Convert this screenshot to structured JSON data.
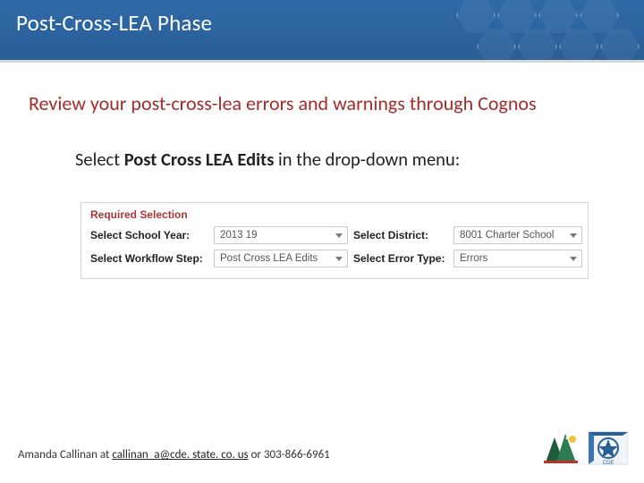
{
  "header": {
    "title": "Post-Cross-LEA Phase"
  },
  "subtitle": "Review your post-cross-lea errors and warnings through Cognos",
  "instruction": {
    "prefix": "Select ",
    "bold": "Post Cross LEA Edits",
    "suffix": " in the drop-down menu:"
  },
  "panel": {
    "legend": "Required Selection",
    "rows": [
      {
        "label1": "Select School Year:",
        "value1": "2013 19",
        "label2": "Select District:",
        "value2": "8001   Charter School"
      },
      {
        "label1": "Select Workflow Step:",
        "value1": "Post Cross LEA Edits",
        "label2": "Select Error Type:",
        "value2": "Errors"
      }
    ]
  },
  "footer": {
    "name": "Amanda Callinan",
    "connector_at": " at ",
    "link_text": "callinan_a@cde. state. co. us",
    "link_href": "mailto:callinan_a@cde.state.co.us",
    "connector_or": " or ",
    "phone": "303-866-6961"
  },
  "logos": {
    "co_alt": "Colorado logo",
    "cde_alt": "CDE logo",
    "cde_label": "CDE"
  }
}
